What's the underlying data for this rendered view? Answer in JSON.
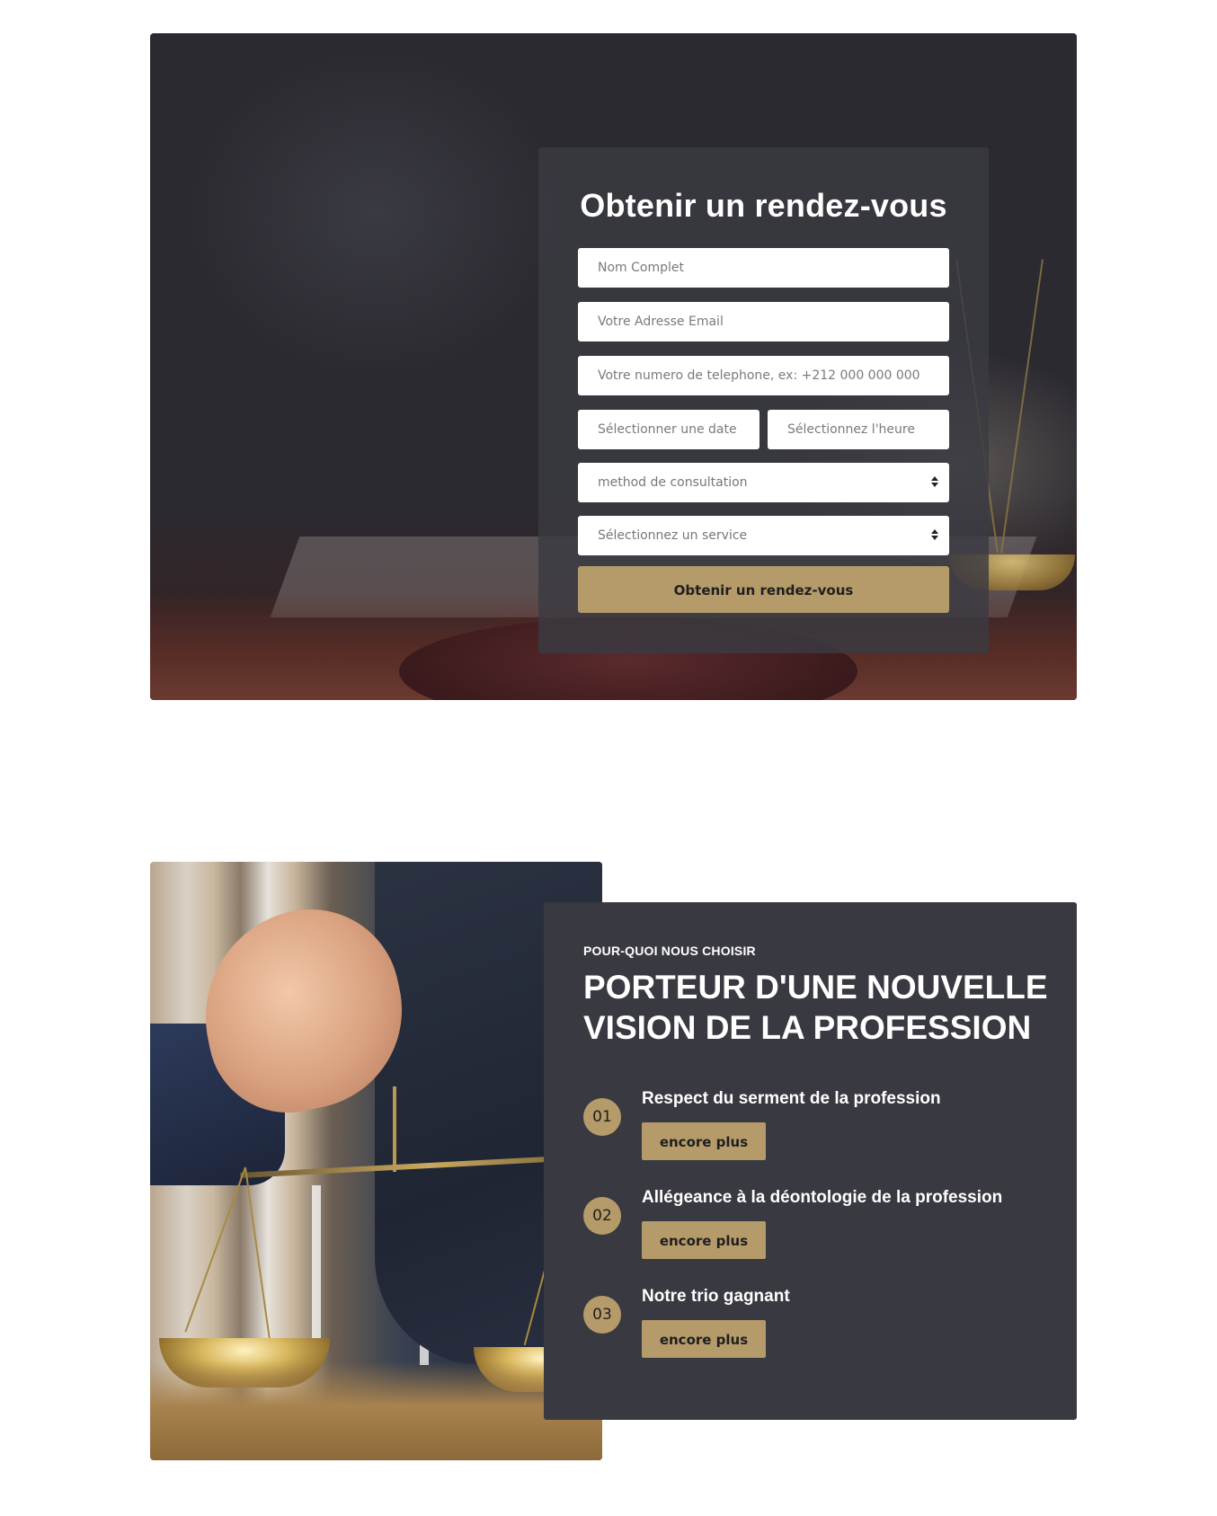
{
  "appointment": {
    "title": "Obtenir un rendez-vous",
    "fields": {
      "name_placeholder": "Nom Complet",
      "email_placeholder": "Votre Adresse Email",
      "phone_placeholder": "Votre numero de telephone, ex: +212 000 000 000",
      "date_placeholder": "Sélectionner une date",
      "time_placeholder": "Sélectionnez l'heure",
      "method_selected": "method de consultation",
      "service_selected": "Sélectionnez un service"
    },
    "submit_label": "Obtenir un rendez-vous"
  },
  "why": {
    "eyebrow": "POUR-QUOI NOUS CHOISIR",
    "title": "PORTEUR D'UNE NOUVELLE VISION DE LA PROFESSION",
    "items": [
      {
        "number": "01",
        "title": "Respect du serment de la profession",
        "button": "encore plus"
      },
      {
        "number": "02",
        "title": "Allégeance à la déontologie de la profession",
        "button": "encore plus"
      },
      {
        "number": "03",
        "title": "Notre trio gagnant",
        "button": "encore plus"
      }
    ]
  },
  "colors": {
    "accent": "#b59b6a",
    "card_dark": "#393941"
  }
}
